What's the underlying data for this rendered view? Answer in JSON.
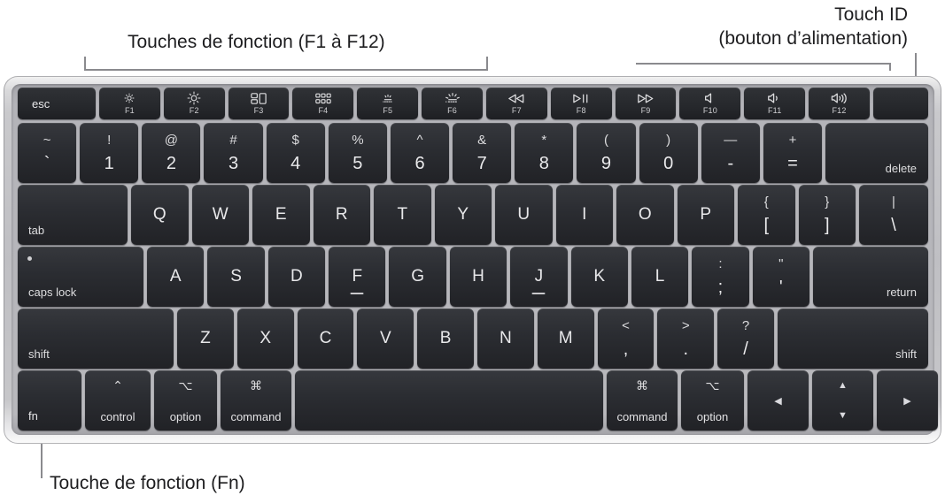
{
  "annotations": {
    "function_keys": "Touches de fonction (F1 à F12)",
    "touch_id_line1": "Touch ID",
    "touch_id_line2": "(bouton d’alimentation)",
    "fn_key": "Touche de fonction (Fn)"
  },
  "colors": {
    "key_face": "#2b2d32",
    "key_text": "#e8e8ea",
    "chassis": "#bfbfc3",
    "keybed": "#b6b6bb",
    "leader_line": "#8a8a8e",
    "annotation_text": "#1d1d1f"
  },
  "keyboard": {
    "layout": "US English — MacBook Air with Touch ID",
    "function_row": [
      {
        "label": "esc",
        "name": "escape"
      },
      {
        "fn": "F1",
        "icon": "brightness-down-icon",
        "name": "brightness-down"
      },
      {
        "fn": "F2",
        "icon": "brightness-up-icon",
        "name": "brightness-up"
      },
      {
        "fn": "F3",
        "icon": "mission-control-icon",
        "name": "mission-control"
      },
      {
        "fn": "F4",
        "icon": "launchpad-grid-icon",
        "name": "launchpad"
      },
      {
        "fn": "F5",
        "icon": "keyboard-backlight-down-icon",
        "name": "keyboard-brightness-down"
      },
      {
        "fn": "F6",
        "icon": "keyboard-backlight-up-icon",
        "name": "keyboard-brightness-up"
      },
      {
        "fn": "F7",
        "icon": "rewind-icon",
        "name": "media-rewind"
      },
      {
        "fn": "F8",
        "icon": "play-pause-icon",
        "name": "media-play-pause"
      },
      {
        "fn": "F9",
        "icon": "fast-forward-icon",
        "name": "media-fast-forward"
      },
      {
        "fn": "F10",
        "icon": "volume-mute-icon",
        "name": "volume-mute"
      },
      {
        "fn": "F11",
        "icon": "volume-down-icon",
        "name": "volume-down"
      },
      {
        "fn": "F12",
        "icon": "volume-up-icon",
        "name": "volume-up"
      },
      {
        "label": "",
        "name": "touch-id-power-button"
      }
    ],
    "number_row": [
      {
        "top": "~",
        "bottom": "`"
      },
      {
        "top": "!",
        "bottom": "1"
      },
      {
        "top": "@",
        "bottom": "2"
      },
      {
        "top": "#",
        "bottom": "3"
      },
      {
        "top": "$",
        "bottom": "4"
      },
      {
        "top": "%",
        "bottom": "5"
      },
      {
        "top": "^",
        "bottom": "6"
      },
      {
        "top": "&",
        "bottom": "7"
      },
      {
        "top": "*",
        "bottom": "8"
      },
      {
        "top": "(",
        "bottom": "9"
      },
      {
        "top": ")",
        "bottom": "0"
      },
      {
        "top": "—",
        "bottom": "-"
      },
      {
        "top": "+",
        "bottom": "="
      },
      {
        "label": "delete"
      }
    ],
    "qwerty_row": {
      "tab": "tab",
      "letters": [
        "Q",
        "W",
        "E",
        "R",
        "T",
        "Y",
        "U",
        "I",
        "O",
        "P"
      ],
      "bracket_left": {
        "top": "{",
        "bottom": "["
      },
      "bracket_right": {
        "top": "}",
        "bottom": "]"
      },
      "backslash": {
        "top": "|",
        "bottom": "\\"
      }
    },
    "home_row": {
      "caps_lock": "caps lock",
      "letters": [
        "A",
        "S",
        "D",
        "F",
        "G",
        "H",
        "J",
        "K",
        "L"
      ],
      "semicolon": {
        "top": ":",
        "bottom": ";"
      },
      "quote": {
        "top": "\"",
        "bottom": "'"
      },
      "return": "return"
    },
    "shift_row": {
      "shift_left": "shift",
      "letters": [
        "Z",
        "X",
        "C",
        "V",
        "B",
        "N",
        "M"
      ],
      "comma": {
        "top": "<",
        "bottom": ","
      },
      "period": {
        "top": ">",
        "bottom": "."
      },
      "slash": {
        "top": "?",
        "bottom": "/"
      },
      "shift_right": "shift"
    },
    "modifier_row": {
      "fn": "fn",
      "control": {
        "symbol": "⌃",
        "label": "control"
      },
      "option_left": {
        "symbol": "⌥",
        "label": "option"
      },
      "command_left": {
        "symbol": "⌘",
        "label": "command"
      },
      "space": "",
      "command_right": {
        "symbol": "⌘",
        "label": "command"
      },
      "option_right": {
        "symbol": "⌥",
        "label": "option"
      },
      "arrow_left": "◀",
      "arrow_up": "▲",
      "arrow_down": "▼",
      "arrow_right": "▶"
    }
  }
}
